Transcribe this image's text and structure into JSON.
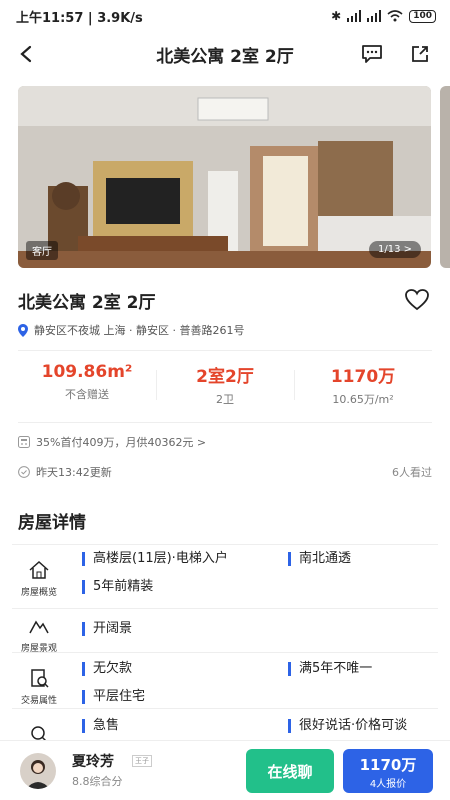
{
  "status_bar": {
    "time": "上午11:57",
    "network_speed": "3.9K/s",
    "battery": "100",
    "icons": [
      "bluetooth-icon",
      "signal-icon",
      "signal-icon",
      "wifi-icon"
    ]
  },
  "nav": {
    "title": "北美公寓 2室 2厅",
    "back_icon": "back-arrow-icon",
    "actions": [
      "message-icon",
      "share-icon"
    ]
  },
  "gallery": {
    "tag": "客厅",
    "counter": "1/13 >"
  },
  "listing": {
    "title": "北美公寓 2室 2厅",
    "address": "静安区不夜城 上海 · 静安区 · 普善路261号"
  },
  "stats": [
    {
      "value": "109.86m²",
      "label": "不含赠送"
    },
    {
      "value": "2室2厅",
      "label": "2卫"
    },
    {
      "value": "1170万",
      "label": "10.65万/m²"
    }
  ],
  "payment": "35%首付409万，月供40362元 >",
  "updated": "昨天13:42更新",
  "views": "6人看过",
  "section_title": "房屋详情",
  "details": [
    {
      "category": "房屋概览",
      "icon": "house-icon",
      "features": [
        "高楼层(11层)·电梯入户",
        "南北通透",
        "5年前精装"
      ]
    },
    {
      "category": "房屋景观",
      "icon": "mountain-icon",
      "features": [
        "开阔景"
      ]
    },
    {
      "category": "交易属性",
      "icon": "document-icon",
      "features": [
        "无欠款",
        "满5年不唯一",
        "平层住宅"
      ]
    },
    {
      "category": "",
      "icon": "search-icon",
      "features": [
        "急售",
        "很好说话·价格可谈"
      ]
    }
  ],
  "agent": {
    "name": "夏玲芳",
    "badge": "王子",
    "score": "8.8综合分"
  },
  "actions": {
    "chat": "在线聊",
    "offer_price": "1170万",
    "offer_sub": "4人报价"
  }
}
